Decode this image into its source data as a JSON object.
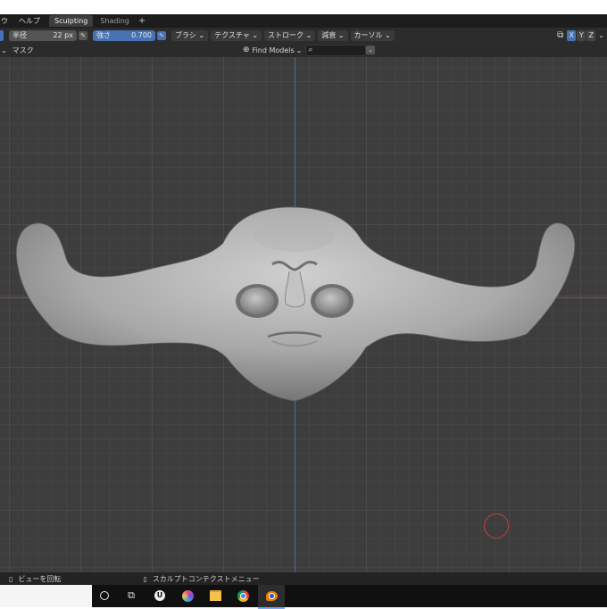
{
  "menubar": {
    "items": [
      "ウ",
      "ヘルプ"
    ],
    "tabs": [
      "Sculpting",
      "Shading"
    ],
    "active_tab": "Sculpting",
    "add_tab": "+"
  },
  "toolbar": {
    "radius_label": "半径",
    "radius_value": "22 px",
    "strength_label": "強さ",
    "strength_value": "0.700",
    "dropdowns": [
      "ブラシ",
      "テクスチャ",
      "ストローク",
      "減衰",
      "カーソル"
    ],
    "axes": [
      "X",
      "Y",
      "Z"
    ]
  },
  "header2": {
    "mask_label": "マスク",
    "find_models": "Find Models"
  },
  "statusbar": {
    "rotate_view": "ビューを回転",
    "context_menu": "スカルプトコンテクストメニュー"
  },
  "taskbar": {
    "icons": [
      "cortana-icon",
      "task-view-icon",
      "unreal-engine-icon",
      "color-app-icon",
      "file-explorer-icon",
      "chrome-icon",
      "blender-icon"
    ]
  },
  "colors": {
    "accent": "#4772b3",
    "viewport_bg": "#3d3d3d",
    "brush_cursor": "#c93a3a"
  }
}
